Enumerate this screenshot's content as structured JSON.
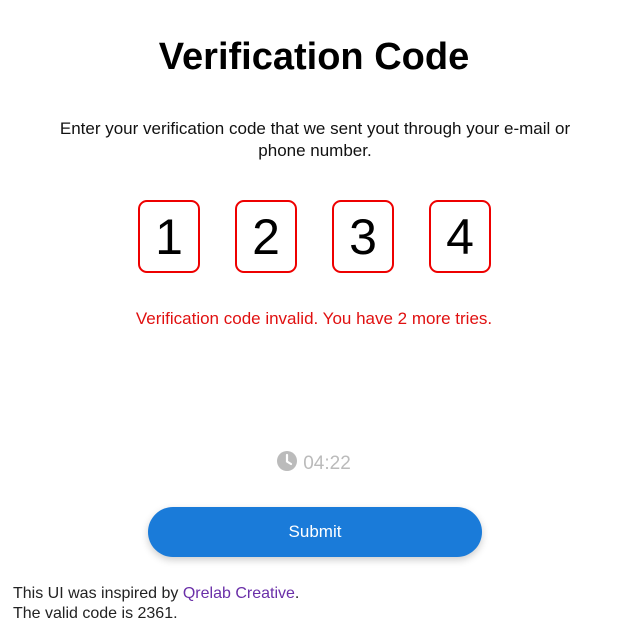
{
  "title": "Verification Code",
  "description": "Enter your verification code that we sent yout through your e-mail or phone number.",
  "code_digits": [
    "1",
    "2",
    "3",
    "4"
  ],
  "error_message": "Verification code invalid. You have 2 more tries.",
  "timer": {
    "icon": "clock-icon",
    "value": "04:22"
  },
  "submit_label": "Submit",
  "footer": {
    "line1_prefix": "This UI was inspired by ",
    "link_text": "Qrelab Creative",
    "line1_suffix": ".",
    "line2": "The valid code is 2361."
  },
  "colors": {
    "accent": "#1a7bd9",
    "error": "#e01010",
    "link": "#6a2fa8"
  }
}
